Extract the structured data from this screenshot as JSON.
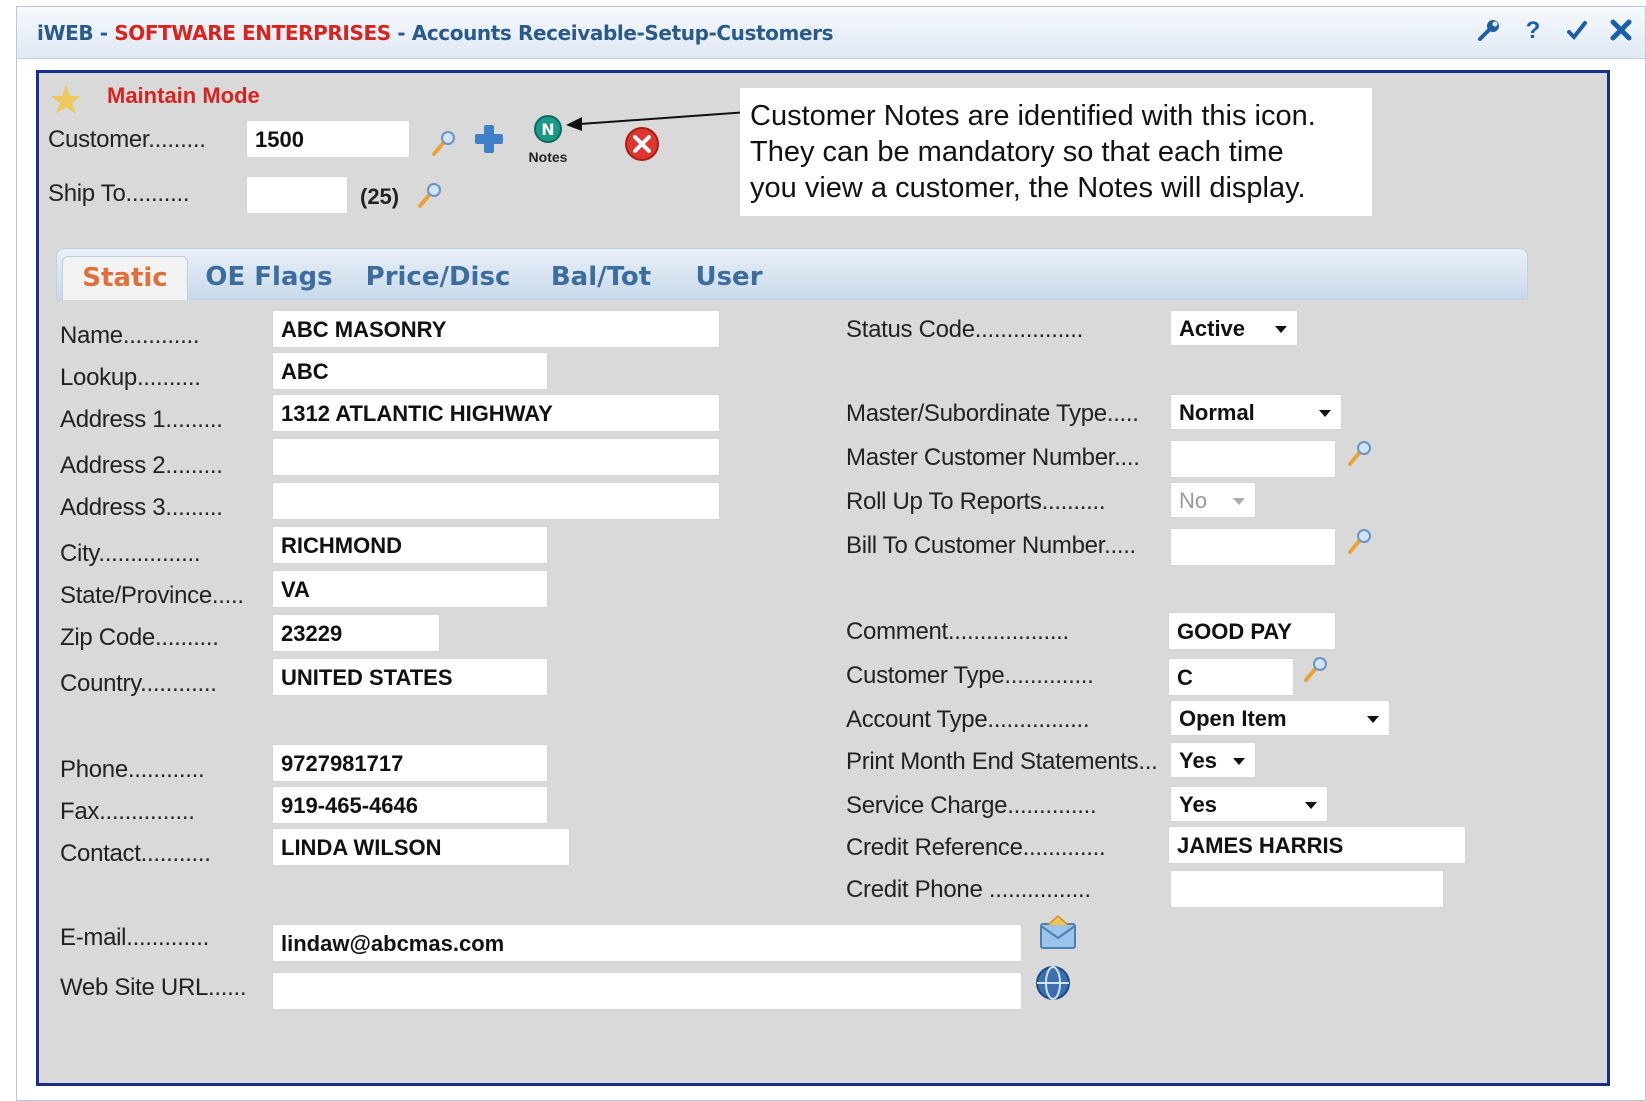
{
  "window": {
    "title_app": "iWEB",
    "title_sep1": " - ",
    "title_company": "SOFTWARE ENTERPRISES",
    "title_sep2": " - ",
    "title_path": "Accounts Receivable-Setup-Customers",
    "icons": [
      "wrench-icon",
      "help-icon",
      "check-icon",
      "close-icon"
    ]
  },
  "mode": {
    "label": "Maintain Mode",
    "icon": "star-icon"
  },
  "header": {
    "customer_label": "Customer.........",
    "customer_value": "1500",
    "shipto_label": "Ship To..........",
    "shipto_value": "",
    "shipto_count": "(25)",
    "notes_badge": "N",
    "notes_label": "Notes"
  },
  "callout": {
    "line1": "Customer Notes are identified with this icon.",
    "line2": "They can be mandatory so that each time",
    "line3": "you view a customer, the Notes will display."
  },
  "tabs": [
    {
      "label": "Static",
      "active": true
    },
    {
      "label": "OE Flags",
      "active": false
    },
    {
      "label": "Price/Disc",
      "active": false
    },
    {
      "label": "Bal/Tot",
      "active": false
    },
    {
      "label": "User",
      "active": false
    }
  ],
  "left": {
    "name": {
      "label": "Name............",
      "value": "ABC MASONRY"
    },
    "lookup": {
      "label": "Lookup..........",
      "value": "ABC"
    },
    "address1": {
      "label": "Address 1.........",
      "value": "1312 ATLANTIC HIGHWAY"
    },
    "address2": {
      "label": "Address 2.........",
      "value": ""
    },
    "address3": {
      "label": "Address 3.........",
      "value": ""
    },
    "city": {
      "label": "City................",
      "value": "RICHMOND"
    },
    "state": {
      "label": "State/Province.....",
      "value": "VA"
    },
    "zip": {
      "label": "Zip Code..........",
      "value": "23229"
    },
    "country": {
      "label": "Country............",
      "value": "UNITED STATES"
    },
    "phone": {
      "label": "Phone............",
      "value": "9727981717"
    },
    "fax": {
      "label": "Fax...............",
      "value": "919-465-4646"
    },
    "contact": {
      "label": "Contact...........",
      "value": "LINDA WILSON"
    },
    "email": {
      "label": "E-mail.............",
      "value": "lindaw@abcmas.com"
    },
    "website": {
      "label": "Web Site URL......",
      "value": ""
    }
  },
  "right": {
    "status_code": {
      "label": "Status Code.................",
      "value": "Active"
    },
    "master_sub_type": {
      "label": "Master/Subordinate Type.....",
      "value": "Normal"
    },
    "master_customer_number": {
      "label": "Master Customer Number....",
      "value": ""
    },
    "roll_up": {
      "label": "Roll Up To Reports..........",
      "value": "No"
    },
    "bill_to": {
      "label": "Bill To Customer Number.....",
      "value": ""
    },
    "comment": {
      "label": "Comment...................",
      "value": "GOOD PAY"
    },
    "customer_type": {
      "label": "Customer Type..............",
      "value": "C"
    },
    "account_type": {
      "label": "Account Type................",
      "value": "Open Item"
    },
    "print_month_end": {
      "label": "Print Month End Statements...",
      "value": "Yes"
    },
    "service_charge": {
      "label": "Service Charge..............",
      "value": "Yes"
    },
    "credit_reference": {
      "label": "Credit Reference.............",
      "value": "JAMES HARRIS"
    },
    "credit_phone": {
      "label": "Credit Phone ................",
      "value": ""
    }
  },
  "colors": {
    "accent_blue": "#1a2f8c",
    "title_red": "#d8231e",
    "tab_active": "#e0703a",
    "tab_inactive": "#3d6d9c",
    "panel_bg": "#d9d9d9"
  }
}
